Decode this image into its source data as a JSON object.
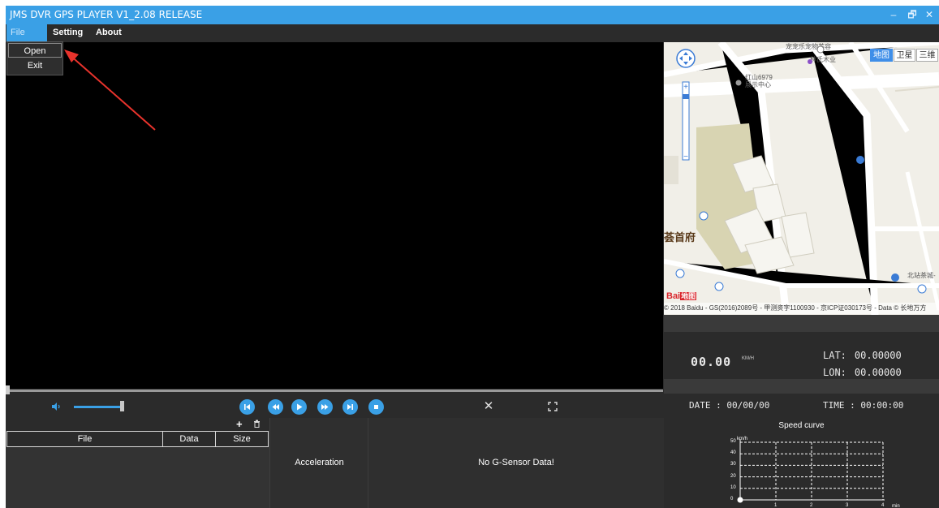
{
  "window": {
    "title": "JMS DVR GPS PLAYER V1_2.08 RELEASE",
    "minimize": "–",
    "restore": "🗗",
    "close": "✕"
  },
  "menu": {
    "items": [
      {
        "label": "File",
        "open": true
      },
      {
        "label": "Setting"
      },
      {
        "label": "About"
      }
    ],
    "dropdown": [
      "Open",
      "Exit"
    ]
  },
  "player": {
    "volume_level": 1.0,
    "seek_position": 0.0,
    "buttons": [
      "skip-to-start",
      "rewind",
      "play",
      "fast-forward",
      "skip-to-end",
      "stop"
    ],
    "close_glyph": "✕"
  },
  "map": {
    "types": [
      {
        "label": "地图",
        "active": true
      },
      {
        "label": "卫星"
      },
      {
        "label": "三维"
      }
    ],
    "labels": {
      "top_poi": "宠宠乐宠物美容",
      "lin_poi": "林氏木业",
      "hongshan_1": "红山6979",
      "hongshan_2": "展示中心",
      "district": "荟首府",
      "bus_station": "北站茶城-"
    },
    "logo": "Bai",
    "logo_suffix": "地图",
    "copyright": "© 2018 Baidu - GS(2016)2089号 - 甲测资字1100930 - 京ICP证030173号 - Data © 长地万方"
  },
  "gps": {
    "speed": "00.00",
    "speed_unit": "KM/H",
    "lat_label": "LAT:",
    "lat": "00.00000",
    "lon_label": "LON:",
    "lon": "00.00000",
    "date_label": "DATE :",
    "date": "00/00/00",
    "time_label": "TIME :",
    "time": "00:00:00"
  },
  "file_list": {
    "add_glyph": "+",
    "delete_glyph": "🗑",
    "columns": [
      "File",
      "Data",
      "Size"
    ]
  },
  "panels": {
    "acceleration": "Acceleration",
    "gsensor": "No G-Sensor Data!"
  },
  "speed_curve": {
    "title": "Speed curve",
    "y_unit": "km/h",
    "x_unit": "min",
    "y_ticks": [
      "50",
      "40",
      "30",
      "20",
      "10",
      "0"
    ],
    "x_ticks": [
      "1",
      "2",
      "3",
      "4"
    ],
    "grid": true,
    "point": {
      "x": 0,
      "y": 0
    }
  },
  "colors": {
    "accent": "#3aa0e6",
    "background": "#2b2b2b",
    "video": "#000000"
  }
}
